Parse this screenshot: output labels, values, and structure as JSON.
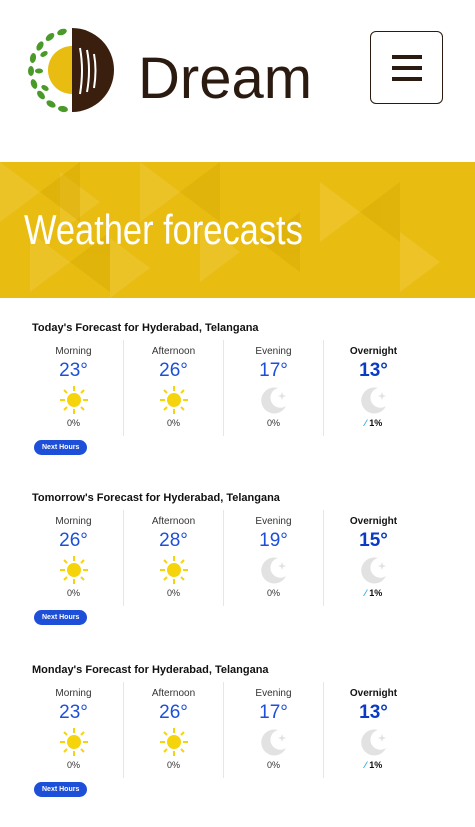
{
  "header": {
    "brand": "Dream",
    "menu_icon": "hamburger-icon",
    "logo_icon": "wheat-leaf-logo"
  },
  "banner": {
    "title": "Weather forecasts",
    "color": "#e8bc10"
  },
  "forecasts": [
    {
      "title": "Today's Forecast for Hyderabad, Telangana",
      "button": "Next Hours",
      "periods": [
        {
          "label": "Morning",
          "temp": "23°",
          "icon": "sun-icon",
          "precip": "0%"
        },
        {
          "label": "Afternoon",
          "temp": "26°",
          "icon": "sun-icon",
          "precip": "0%"
        },
        {
          "label": "Evening",
          "temp": "17°",
          "icon": "moon-icon",
          "precip": "0%"
        },
        {
          "label": "Overnight",
          "temp": "13°",
          "icon": "moon-icon",
          "precip": "1%"
        }
      ]
    },
    {
      "title": "Tomorrow's Forecast for Hyderabad, Telangana",
      "button": "Next Hours",
      "periods": [
        {
          "label": "Morning",
          "temp": "26°",
          "icon": "sun-icon",
          "precip": "0%"
        },
        {
          "label": "Afternoon",
          "temp": "28°",
          "icon": "sun-icon",
          "precip": "0%"
        },
        {
          "label": "Evening",
          "temp": "19°",
          "icon": "moon-icon",
          "precip": "0%"
        },
        {
          "label": "Overnight",
          "temp": "15°",
          "icon": "moon-icon",
          "precip": "1%"
        }
      ]
    },
    {
      "title": "Monday's Forecast for Hyderabad, Telangana",
      "button": "Next Hours",
      "periods": [
        {
          "label": "Morning",
          "temp": "23°",
          "icon": "sun-icon",
          "precip": "0%"
        },
        {
          "label": "Afternoon",
          "temp": "26°",
          "icon": "sun-icon",
          "precip": "0%"
        },
        {
          "label": "Evening",
          "temp": "17°",
          "icon": "moon-icon",
          "precip": "0%"
        },
        {
          "label": "Overnight",
          "temp": "13°",
          "icon": "moon-icon",
          "precip": "1%"
        }
      ]
    }
  ]
}
